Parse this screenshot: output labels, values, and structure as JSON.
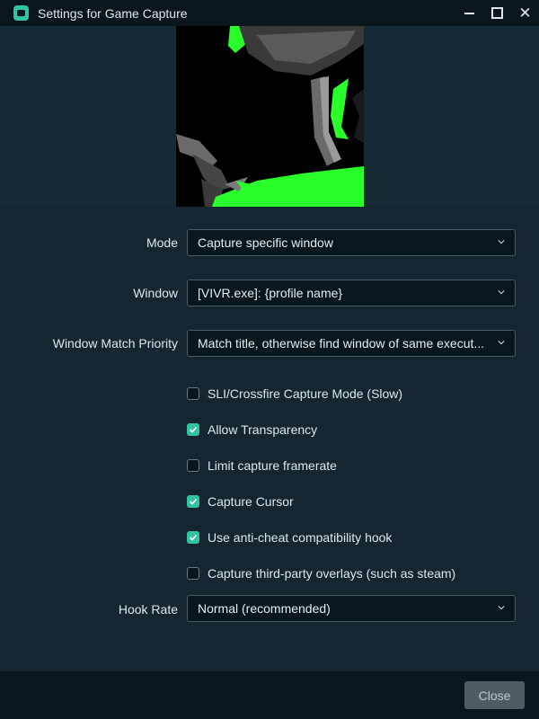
{
  "window": {
    "title": "Settings for Game Capture",
    "icon": "streamlabs-app-icon",
    "controls": [
      "minimize-icon",
      "maximize-icon",
      "close-icon"
    ]
  },
  "form": {
    "mode": {
      "label": "Mode",
      "value": "Capture specific window"
    },
    "window": {
      "label": "Window",
      "value": "[VIVR.exe]: {profile name}"
    },
    "match_priority": {
      "label": "Window Match Priority",
      "value": "Match title, otherwise find window of same execut..."
    },
    "hook_rate": {
      "label": "Hook Rate",
      "value": "Normal (recommended)"
    }
  },
  "checkboxes": [
    {
      "label": "SLI/Crossfire Capture Mode (Slow)",
      "checked": false
    },
    {
      "label": "Allow Transparency",
      "checked": true
    },
    {
      "label": "Limit capture framerate",
      "checked": false
    },
    {
      "label": "Capture Cursor",
      "checked": true
    },
    {
      "label": "Use anti-cheat compatibility hook",
      "checked": true
    },
    {
      "label": "Capture third-party overlays (such as steam)",
      "checked": false
    }
  ],
  "footer": {
    "close_label": "Close"
  },
  "colors": {
    "accent": "#31c3a2",
    "panel": "#152631",
    "background": "#09161d",
    "preview_green": "#2bff2b"
  }
}
